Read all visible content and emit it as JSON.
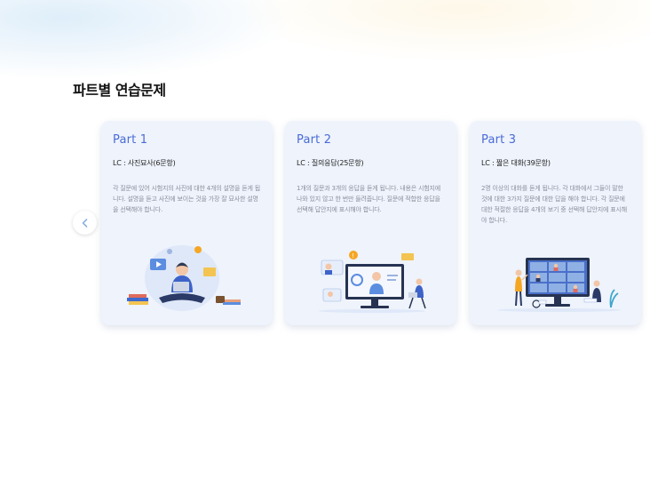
{
  "section": {
    "title": "파트별 연습문제"
  },
  "cards": [
    {
      "title": "Part 1",
      "sub": "LC : 사진묘사(6문항)",
      "desc": "각 질문에 있어 시험지의 사진에 대한 4개의 설명을 듣게 됩니다. 설명을 듣고 사진에 보이는 것을 가장 잘 묘사한 설명을 선택해야 합니다."
    },
    {
      "title": "Part 2",
      "sub": "LC : 질의응답(25문항)",
      "desc": "1개의 질문과 3개의 응답을 듣게 됩니다. 내용은 시험지에 나와 있지 않고 한 번만 들려줍니다. 질문에 적합한 응답을 선택해 답안지에 표시해야 합니다."
    },
    {
      "title": "Part 3",
      "sub": "LC : 짧은 대화(39문항)",
      "desc": "2명 이상의 대화를 듣게 됩니다. 각 대화에서 그들이 말한 것에 대한 3가지 질문에 대한 답을 해야 합니다. 각 질문에 대한 적절한 응답을 4개의 보기 중 선택해 답안지에 표시해야 합니다."
    }
  ],
  "icons": {
    "prev": "chevron-left-icon",
    "illustrations": [
      "student-laptop-illustration",
      "online-meeting-illustration",
      "video-conference-illustration"
    ]
  },
  "colors": {
    "accent": "#4a6bd6",
    "card_bg": "#eef3fc",
    "desc_text": "#8a8f9b"
  }
}
